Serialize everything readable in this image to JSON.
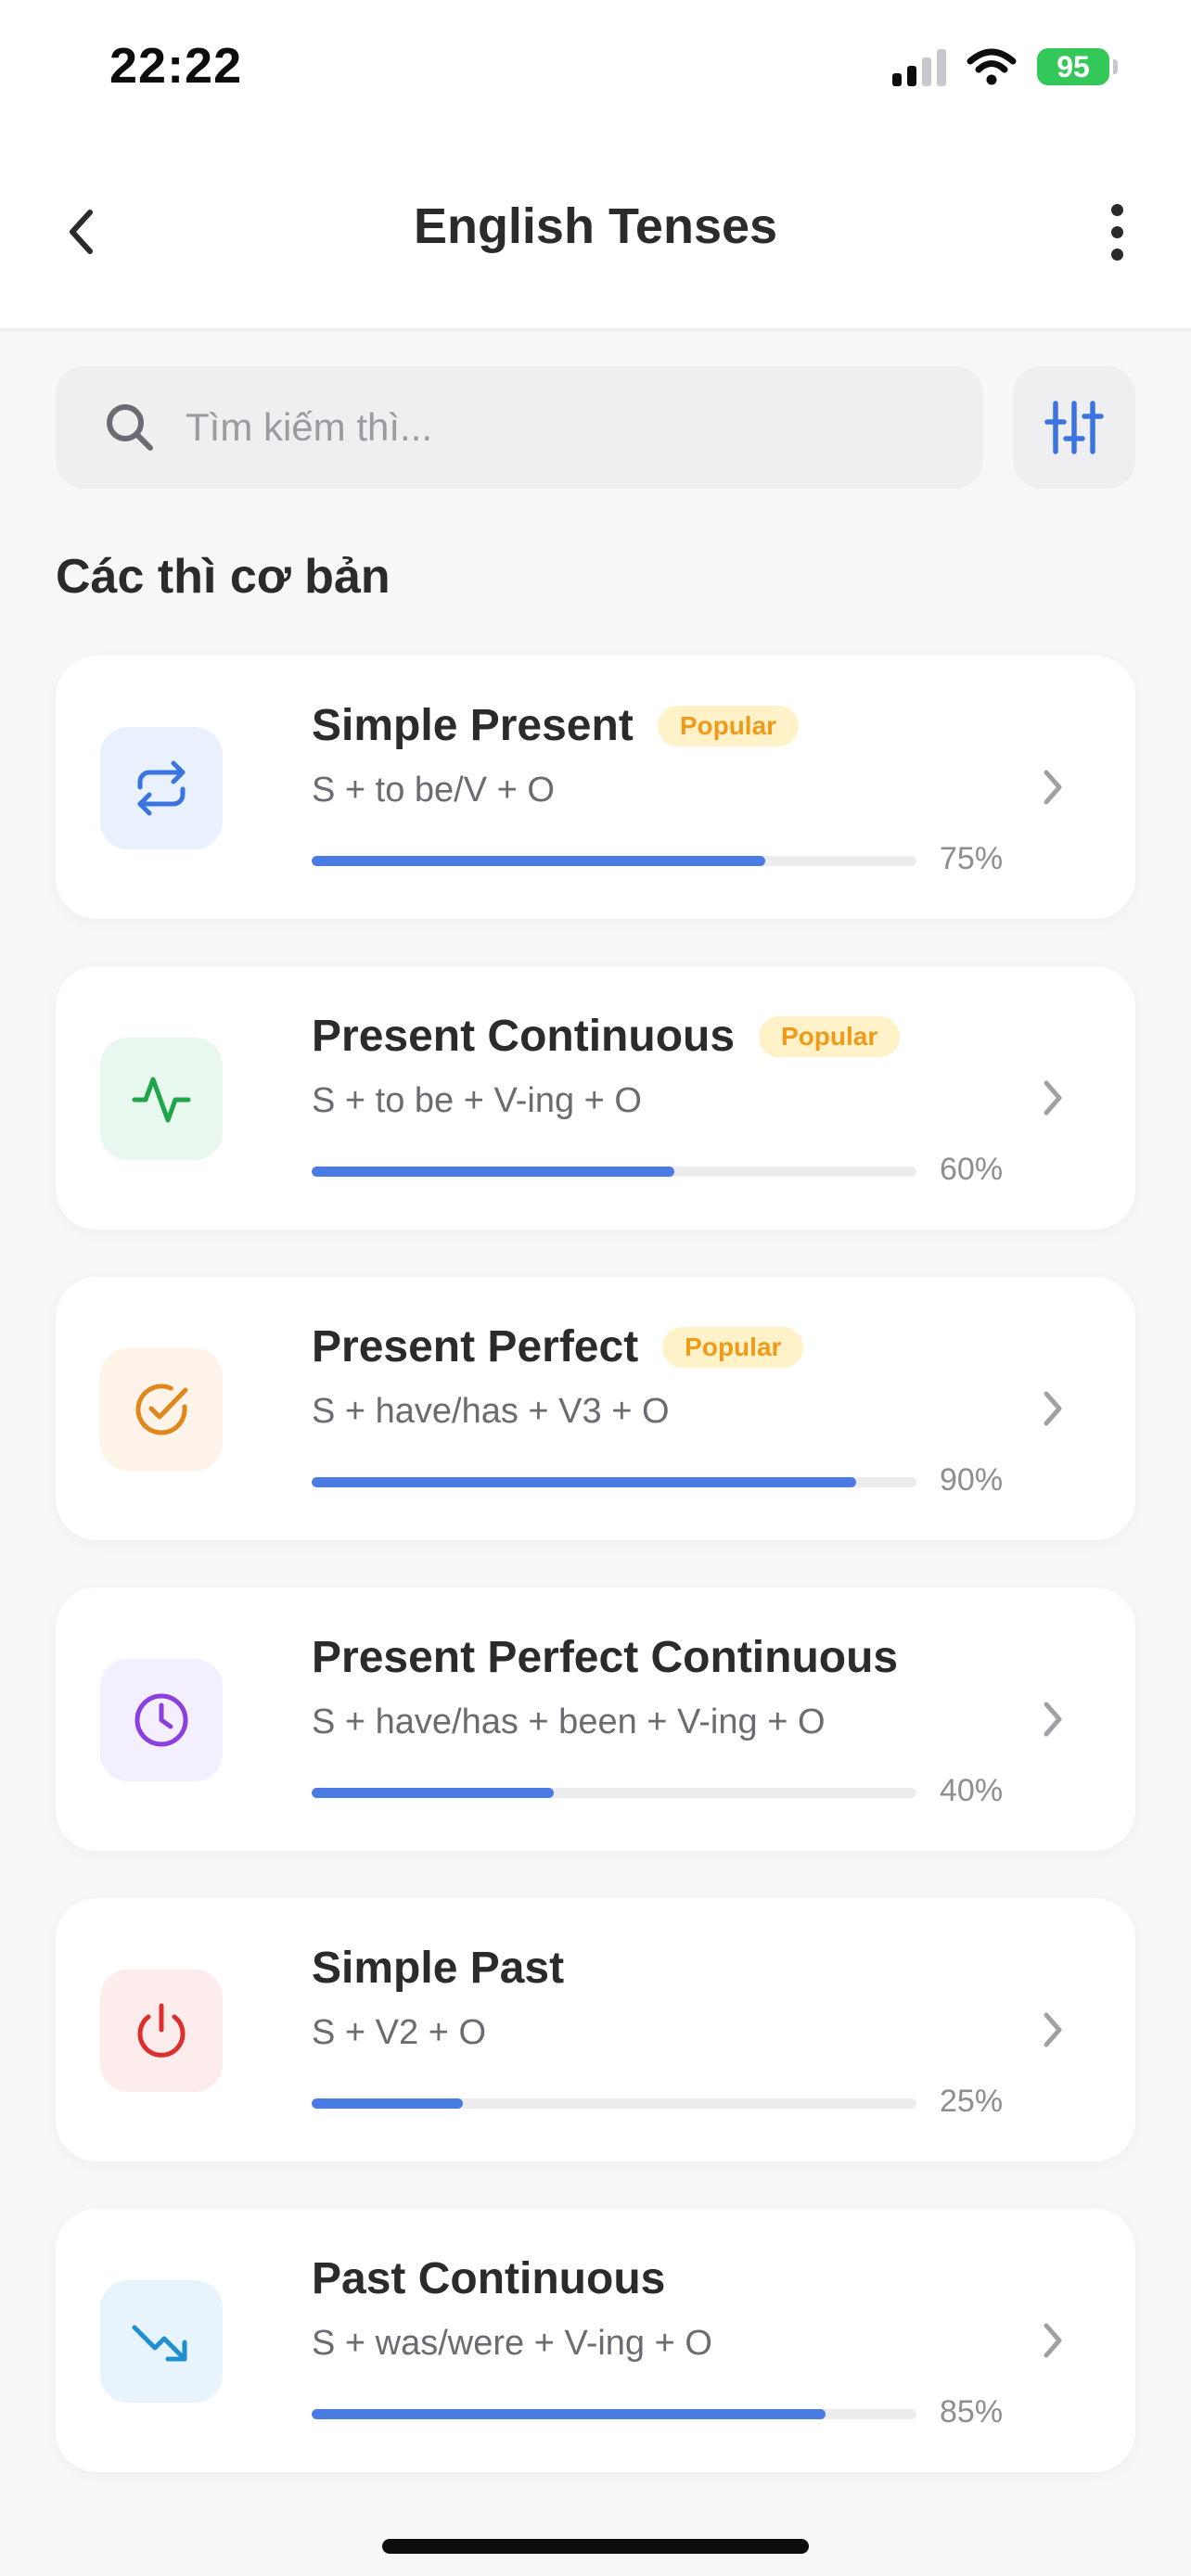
{
  "status": {
    "time": "22:22",
    "battery": "95"
  },
  "nav": {
    "title": "English Tenses"
  },
  "search": {
    "placeholder": "Tìm kiếm thì..."
  },
  "section": {
    "title": "Các thì cơ bản"
  },
  "colors": {
    "accent": "#4a7be3",
    "badge_bg": "#fff2c8",
    "badge_text": "#f09a1a"
  },
  "tenses": [
    {
      "name": "Simple Present",
      "badge": "Popular",
      "formula": "S + to be/V + O",
      "progress": 75,
      "progress_label": "75%",
      "icon": "repeat-icon",
      "icon_color": "#3b74e0",
      "tile_bg": "#eaf1fe"
    },
    {
      "name": "Present Continuous",
      "badge": "Popular",
      "formula": "S + to be + V-ing + O",
      "progress": 60,
      "progress_label": "60%",
      "icon": "activity-icon",
      "icon_color": "#20a64a",
      "tile_bg": "#e9f8ee"
    },
    {
      "name": "Present Perfect",
      "badge": "Popular",
      "formula": "S + have/has + V3 + O",
      "progress": 90,
      "progress_label": "90%",
      "icon": "check-circle-icon",
      "icon_color": "#e0861a",
      "tile_bg": "#fef3e8"
    },
    {
      "name": "Present Perfect Continuous",
      "badge": "",
      "formula": "S + have/has + been + V-ing + O",
      "progress": 40,
      "progress_label": "40%",
      "icon": "clock-icon",
      "icon_color": "#8b3fe0",
      "tile_bg": "#f3effe"
    },
    {
      "name": "Simple Past",
      "badge": "",
      "formula": "S + V2 + O",
      "progress": 25,
      "progress_label": "25%",
      "icon": "power-icon",
      "icon_color": "#de2f2f",
      "tile_bg": "#fdecec"
    },
    {
      "name": "Past Continuous",
      "badge": "",
      "formula": "S + was/were + V-ing + O",
      "progress": 85,
      "progress_label": "85%",
      "icon": "trending-down-icon",
      "icon_color": "#1f8fd0",
      "tile_bg": "#e8f4fc"
    }
  ]
}
